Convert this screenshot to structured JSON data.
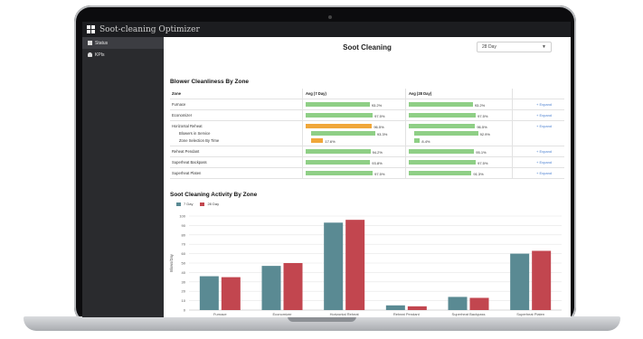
{
  "app": {
    "title": "Soot-cleaning Optimizer"
  },
  "sidebar": {
    "items": [
      {
        "label": "Status"
      },
      {
        "label": "KPIs"
      }
    ]
  },
  "page": {
    "title": "Soot Cleaning"
  },
  "range_select": {
    "value": "28 Day"
  },
  "cleanliness": {
    "title": "Blower Cleanliness By Zone",
    "columns": [
      "Zone",
      "Avg (7 Day)",
      "Avg (28 Day)"
    ],
    "rows": [
      {
        "zone": "Furnace",
        "avg7": 93.2,
        "avg7_label": "93.2%",
        "avg28": 93.2,
        "avg28_label": "93.2%",
        "expand": "+ Expand"
      },
      {
        "zone": "Economizer",
        "avg7": 97.5,
        "avg7_label": "97.5%",
        "avg28": 97.5,
        "avg28_label": "97.5%",
        "expand": "+ Expand"
      },
      {
        "zone": "Horizontal Reheat",
        "avg7": 96.5,
        "avg7_label": "96.5%",
        "avg28": 96.5,
        "avg28_label": "96.5%",
        "expand": "+ Expand",
        "sub": [
          {
            "label": "Blowers in Service",
            "avg7": 93.3,
            "avg7_label": "93.3%",
            "avg28": 92.9,
            "avg28_label": "92.9%"
          },
          {
            "label": "Zone Selection By Time",
            "avg7": 17.6,
            "avg7_label": "17.6%",
            "avg28": 8.4,
            "avg28_label": "8.4%"
          }
        ]
      },
      {
        "zone": "Reheat Pendant",
        "avg7": 94.2,
        "avg7_label": "94.2%",
        "avg28": 95.1,
        "avg28_label": "95.1%",
        "expand": "+ Expand"
      },
      {
        "zone": "Superheat Backpass",
        "avg7": 93.8,
        "avg7_label": "93.8%",
        "avg28": 97.5,
        "avg28_label": "97.5%",
        "expand": "+ Expand"
      },
      {
        "zone": "Superheat Platen",
        "avg7": 97.5,
        "avg7_label": "97.5%",
        "avg28": 91.3,
        "avg28_label": "91.3%",
        "expand": "+ Expand"
      }
    ]
  },
  "activity": {
    "title": "Soot Cleaning Activity By Zone"
  },
  "colors": {
    "series_7day": "#5a8a93",
    "series_28day": "#c2464f",
    "bar_good": "#8fcf86",
    "bar_warn": "#f0a73a"
  },
  "chart_data": {
    "type": "bar",
    "categories": [
      "Furnace",
      "Economizer",
      "Horizontal Reheat",
      "Reheat Pendant",
      "Superheat Backpass",
      "Superheat Platen"
    ],
    "series": [
      {
        "name": "7 Day",
        "values": [
          36,
          47,
          93,
          5,
          14,
          60
        ]
      },
      {
        "name": "28 Day",
        "values": [
          35,
          50,
          96,
          4,
          13,
          63
        ]
      }
    ],
    "ylabel": "Blows/Day",
    "ylim": [
      0,
      100
    ],
    "yticks": [
      0,
      10,
      20,
      30,
      40,
      50,
      60,
      70,
      80,
      90,
      100
    ],
    "grid": true,
    "legend": "top-left"
  }
}
